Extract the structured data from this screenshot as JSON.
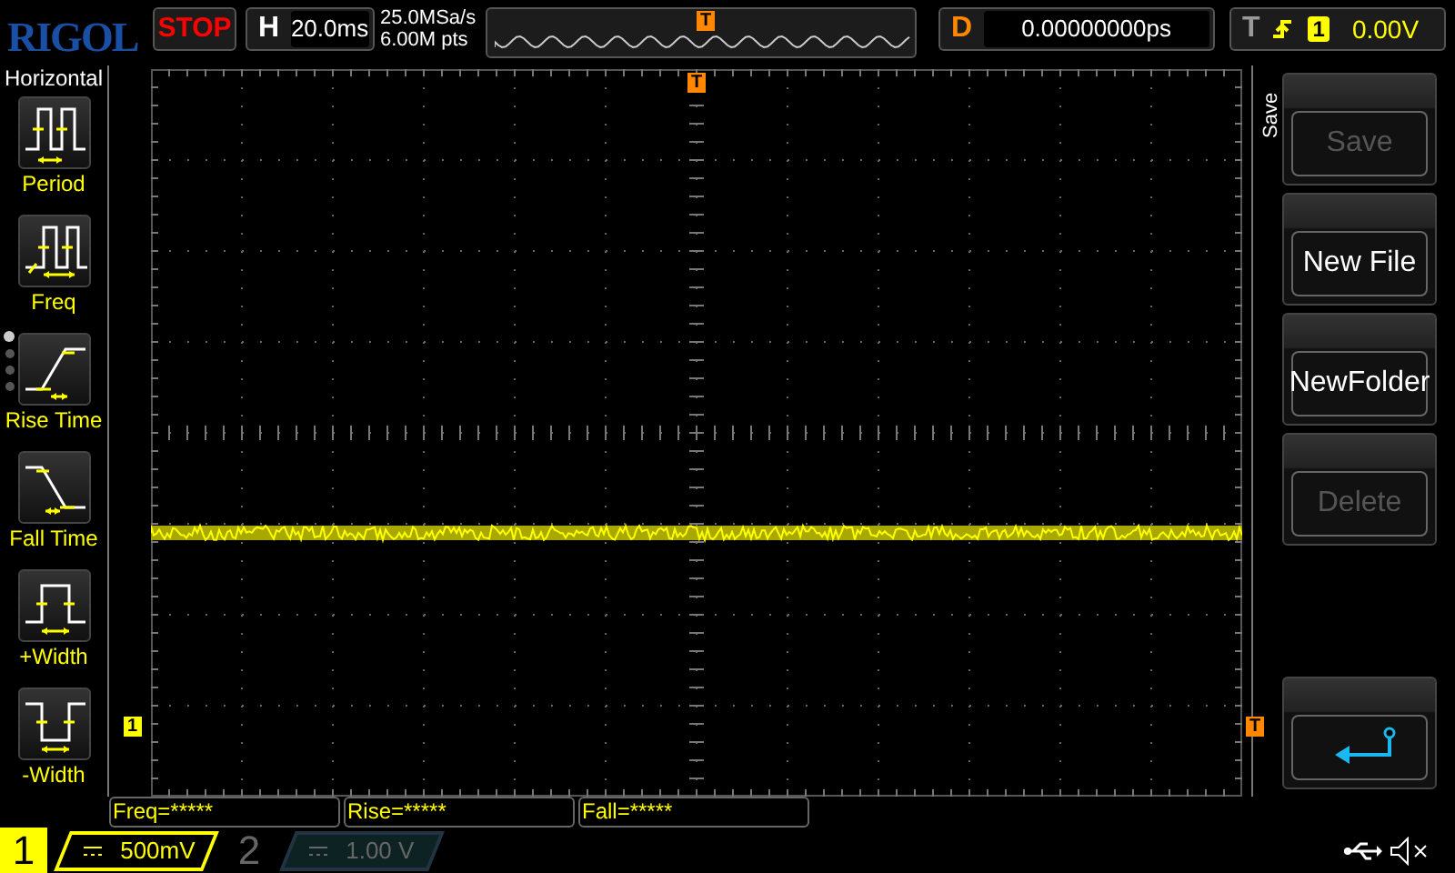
{
  "brand": "RIGOL",
  "run_state": "STOP",
  "timebase": {
    "label": "H",
    "value": "20.0ms"
  },
  "sample_rate": "25.0MSa/s",
  "memory_depth": "6.00M pts",
  "navigator_trigger_marker": "T",
  "trigger_position_marker": "T",
  "delay": {
    "label": "D",
    "value": "0.00000000ps"
  },
  "trigger": {
    "label": "T",
    "source": "1",
    "level": "0.00V"
  },
  "left_menu": {
    "title": "Horizontal",
    "items": [
      {
        "kind": "period",
        "label": "Period"
      },
      {
        "kind": "freq",
        "label": "Freq"
      },
      {
        "kind": "rise",
        "label": "Rise Time"
      },
      {
        "kind": "fall",
        "label": "Fall Time"
      },
      {
        "kind": "pwidth",
        "label": "+Width"
      },
      {
        "kind": "nwidth",
        "label": "-Width"
      }
    ],
    "pages": [
      {
        "selected": true
      },
      {
        "selected": false
      },
      {
        "selected": false
      },
      {
        "selected": false
      }
    ]
  },
  "right_menu": {
    "title": "Save",
    "buttons": [
      {
        "kind": "text",
        "label": "Save",
        "disabled": true
      },
      {
        "kind": "text",
        "label": "New File",
        "disabled": false
      },
      {
        "kind": "text",
        "label": "NewFolder",
        "disabled": false
      },
      {
        "kind": "text",
        "label": "Delete",
        "disabled": true
      },
      {
        "kind": "back"
      }
    ]
  },
  "markers": {
    "channel": "1",
    "trigger_level": "T"
  },
  "measurements": [
    "Freq=*****",
    "Rise=*****",
    "Fall=*****"
  ],
  "channels": [
    {
      "number": "1",
      "scale": "500mV",
      "on": true
    },
    {
      "number": "2",
      "scale": "1.00 V",
      "on": false
    }
  ]
}
